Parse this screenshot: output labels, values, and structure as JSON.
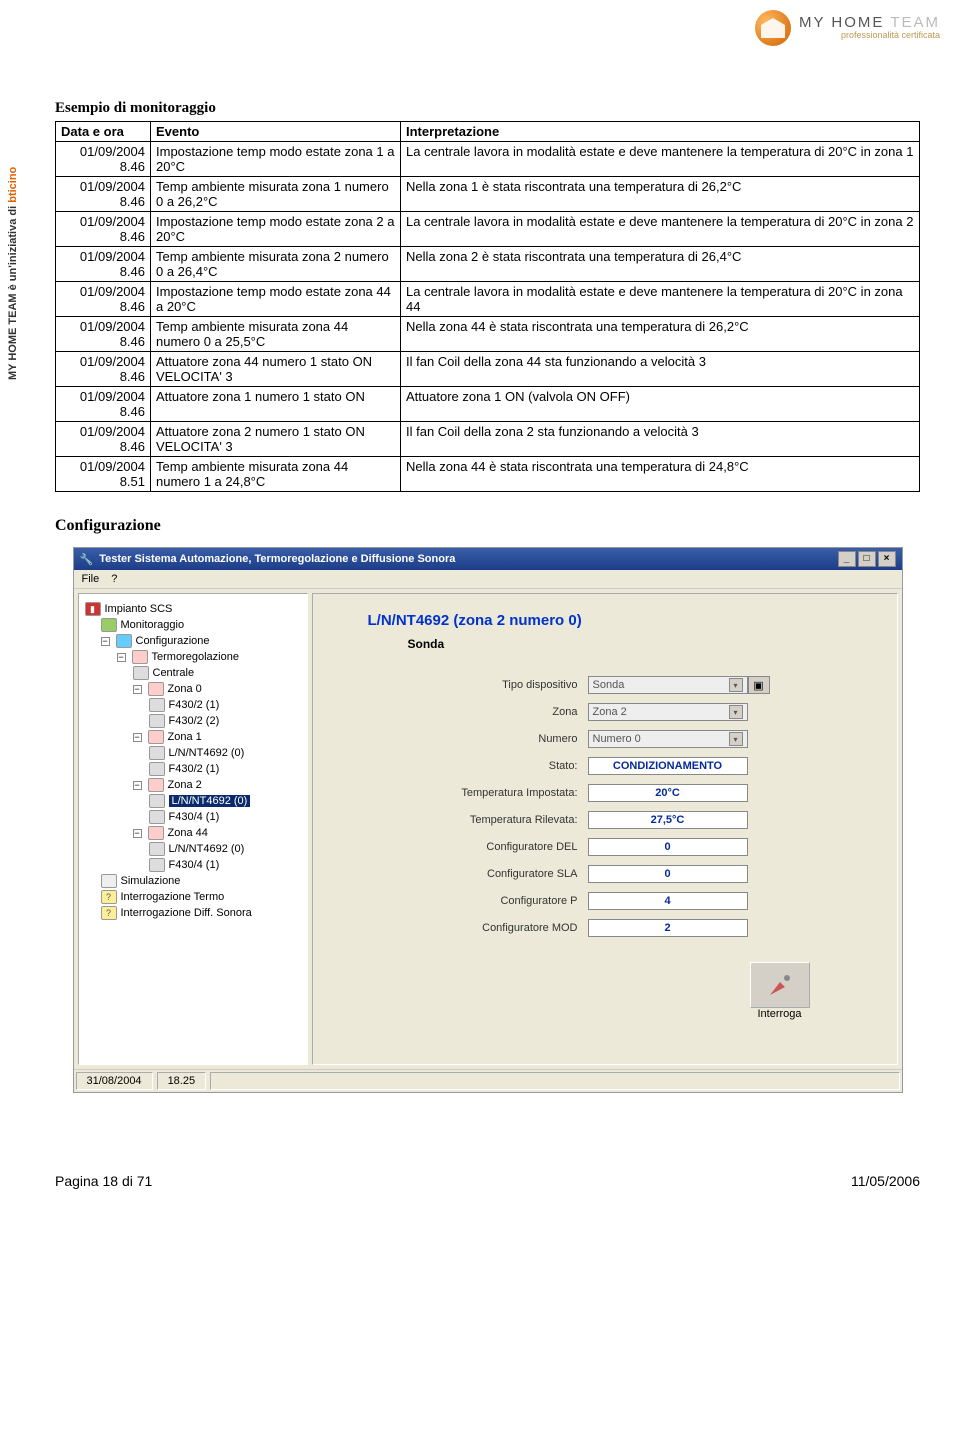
{
  "branding": {
    "sidebar": "MY HOME TEAM è un'iniziativa di",
    "sidebar_brand": "bticino",
    "logo_main_a": "MY HOME",
    "logo_main_b": "TEAM",
    "logo_sub": "professionalità certificata"
  },
  "section_title": "Esempio di monitoraggio",
  "table": {
    "headers": [
      "Data e ora",
      "Evento",
      "Interpretazione"
    ],
    "rows": [
      {
        "dt": "01/09/2004\n8.46",
        "ev": "Impostazione temp modo estate zona 1 a 20°C",
        "int": "La centrale lavora in modalità estate e deve mantenere la temperatura di 20°C in zona 1"
      },
      {
        "dt": "01/09/2004\n8.46",
        "ev": "Temp ambiente misurata zona 1 numero 0 a 26,2°C",
        "int": "Nella zona 1 è stata riscontrata una temperatura di 26,2°C"
      },
      {
        "dt": "01/09/2004\n8.46",
        "ev": "Impostazione temp modo estate zona 2 a 20°C",
        "int": "La centrale lavora in modalità estate e deve mantenere la temperatura di 20°C in zona 2"
      },
      {
        "dt": "01/09/2004\n8.46",
        "ev": "Temp ambiente misurata zona 2 numero 0 a 26,4°C",
        "int": "Nella zona 2 è stata riscontrata una temperatura di 26,4°C"
      },
      {
        "dt": "01/09/2004\n8.46",
        "ev": "Impostazione temp modo estate zona 44 a 20°C",
        "int": "La centrale lavora in modalità estate e deve mantenere la temperatura di 20°C in zona 44"
      },
      {
        "dt": "01/09/2004\n8.46",
        "ev": "Temp ambiente misurata zona 44 numero 0 a 25,5°C",
        "int": "Nella zona 44 è stata riscontrata una temperatura di 26,2°C"
      },
      {
        "dt": "01/09/2004\n8.46",
        "ev": "Attuatore zona 44 numero 1 stato ON VELOCITA' 3",
        "int": "Il fan Coil della zona 44 sta funzionando a velocità 3"
      },
      {
        "dt": "01/09/2004\n8.46",
        "ev": "Attuatore zona 1 numero 1 stato ON",
        "int": "Attuatore zona 1 ON (valvola ON OFF)"
      },
      {
        "dt": "01/09/2004\n8.46",
        "ev": "Attuatore zona 2 numero 1 stato ON VELOCITA' 3",
        "int": "Il fan Coil della zona 2 sta funzionando a velocità 3"
      },
      {
        "dt": "01/09/2004\n8.51",
        "ev": "Temp ambiente misurata zona 44 numero 1 a 24,8°C",
        "int": "Nella zona 44 è stata riscontrata una temperatura di 24,8°C"
      }
    ]
  },
  "config_heading": "Configurazione",
  "app": {
    "title": "Tester Sistema Automazione, Termoregolazione e Diffusione Sonora",
    "menus": [
      "File",
      "?"
    ],
    "tree": {
      "root": "Impianto SCS",
      "monitoraggio": "Monitoraggio",
      "configurazione": "Configurazione",
      "termoregolazione": "Termoregolazione",
      "centrale": "Centrale",
      "zona0": "Zona 0",
      "z0a": "F430/2 (1)",
      "z0b": "F430/2 (2)",
      "zona1": "Zona 1",
      "z1a": "L/N/NT4692 (0)",
      "z1b": "F430/2 (1)",
      "zona2": "Zona 2",
      "z2a": "L/N/NT4692 (0)",
      "z2b": "F430/4 (1)",
      "zona44": "Zona 44",
      "z44a": "L/N/NT4692 (0)",
      "z44b": "F430/4 (1)",
      "simulazione": "Simulazione",
      "int_termo": "Interrogazione Termo",
      "int_diff": "Interrogazione Diff. Sonora"
    },
    "detail": {
      "title": "L/N/NT4692 (zona 2 numero 0)",
      "subtitle": "Sonda",
      "labels": {
        "tipo": "Tipo dispositivo",
        "zona": "Zona",
        "numero": "Numero",
        "stato": "Stato:",
        "timp": "Temperatura Impostata:",
        "tril": "Temperatura Rilevata:",
        "cdel": "Configuratore DEL",
        "csla": "Configuratore SLA",
        "cp": "Configuratore P",
        "cmod": "Configuratore MOD"
      },
      "values": {
        "tipo": "Sonda",
        "zona": "Zona 2",
        "numero": "Numero 0",
        "stato": "CONDIZIONAMENTO",
        "timp": "20°C",
        "tril": "27,5°C",
        "cdel": "0",
        "csla": "0",
        "cp": "4",
        "cmod": "2"
      },
      "interroga": "Interroga"
    },
    "status": {
      "date": "31/08/2004",
      "time": "18.25"
    }
  },
  "footer": {
    "left": "Pagina 18 di 71",
    "right": "11/05/2006"
  }
}
